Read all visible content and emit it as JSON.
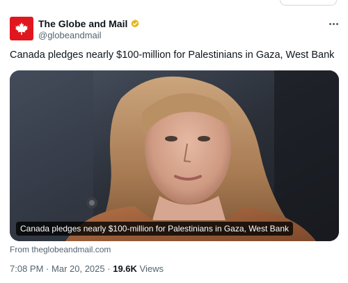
{
  "author": {
    "name": "The Globe and Mail",
    "handle": "@globeandmail",
    "avatar_color": "#e0171f",
    "verified_badge_color": "#e2b719"
  },
  "tweet": {
    "text": "Canada pledges nearly $100-million for Palestinians in Gaza, West Bank",
    "media_caption": "Canada pledges nearly $100-million for Palestinians in Gaza, West Bank",
    "source_link": "From theglobeandmail.com",
    "time": "7:08 PM",
    "separator": "·",
    "date": "Mar 20, 2025",
    "views_count": "19.6K",
    "views_label": "Views"
  },
  "icons": {
    "avatar_logo": "maple-leaf-icon",
    "verified": "verified-badge-icon",
    "more": "more-options-icon"
  }
}
